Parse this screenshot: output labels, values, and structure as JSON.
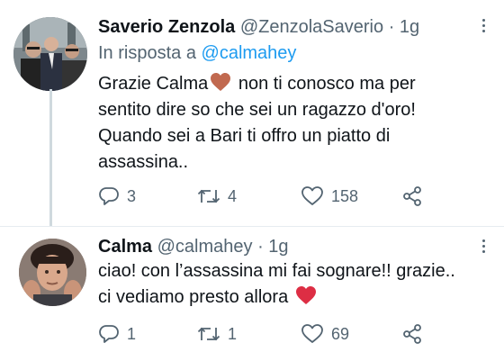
{
  "tweets": [
    {
      "name": "Saverio Zenzola",
      "handle": "@ZenzolaSaverio",
      "separator": "·",
      "time": "1g",
      "reply_prefix": "In risposta a ",
      "reply_mention": "@calmahey",
      "text_lines": [
        "Grazie Calma",
        " non ti conosco ma per",
        "sentito dire so che sei un ragazzo d'oro!",
        "Quando sei a Bari ti offro un piatto di",
        "assassina.."
      ],
      "emoji": "brown-heart",
      "emoji_color": "#c1694f",
      "replies": "3",
      "retweets": "4",
      "likes": "158"
    },
    {
      "name": "Calma",
      "handle": "@calmahey",
      "separator": "·",
      "time": "1g",
      "text_lines": [
        "ciao! con l’assassina mi fai sognare!! grazie..",
        "ci vediamo presto allora "
      ],
      "emoji": "red-heart",
      "emoji_color": "#dd2e44",
      "replies": "1",
      "retweets": "1",
      "likes": "69"
    }
  ],
  "colors": {
    "text": "#0f1419",
    "secondary": "#536471",
    "link": "#1d9bf0",
    "thread_line": "#cfd9de",
    "divider": "#e6ecf0"
  },
  "icons": [
    "reply-icon",
    "retweet-icon",
    "like-icon",
    "share-icon",
    "more-icon"
  ]
}
